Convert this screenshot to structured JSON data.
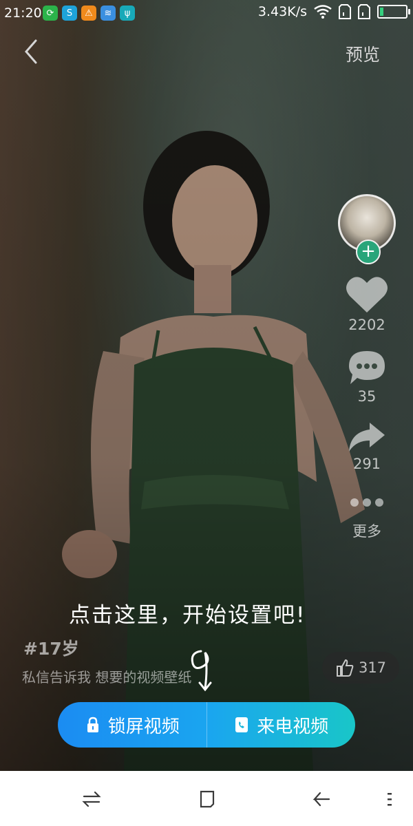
{
  "status_bar": {
    "time": "21:20",
    "net_speed": "3.43K/s",
    "icons": [
      "cycle-icon",
      "swirl-icon",
      "warning-icon",
      "wifi-file-icon",
      "usb-icon"
    ],
    "battery_level": 0.15
  },
  "top_bar": {
    "back_icon": "back-icon",
    "preview_label": "预览"
  },
  "actions": {
    "likes": "2202",
    "comments": "35",
    "shares": "291",
    "more_label": "更多"
  },
  "hint": {
    "text": "点击这里，开始设置吧!"
  },
  "caption": {
    "hashtag": "#17岁",
    "description": "私信告诉我 想要的视频壁纸"
  },
  "like_pill": {
    "count": "317"
  },
  "cta": {
    "lockscreen_label": "锁屏视频",
    "callscreen_label": "来电视频"
  },
  "colors": {
    "accent_start": "#1b8cf2",
    "accent_end": "#19c6c8",
    "follow_green": "#29a57a"
  }
}
